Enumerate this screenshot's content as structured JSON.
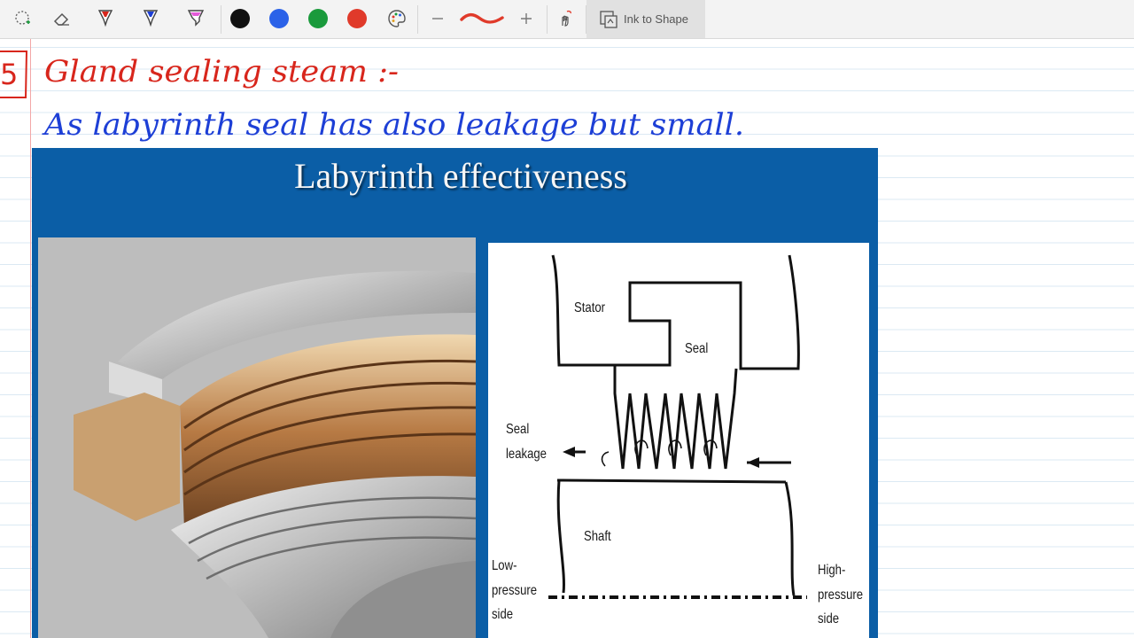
{
  "toolbar": {
    "tools": [
      {
        "name": "lasso-select"
      },
      {
        "name": "eraser"
      },
      {
        "name": "pen-red"
      },
      {
        "name": "pen-blue"
      },
      {
        "name": "highlighter-pink"
      }
    ],
    "colors": [
      "#111111",
      "#2b62e8",
      "#1a9a3c",
      "#e03a2a"
    ],
    "ink_to_shape_label": "Ink to Shape"
  },
  "notes": {
    "number": "5",
    "heading": "Gland sealing steam :-",
    "line": "As labyrinth seal has also leakage but small."
  },
  "slide": {
    "title": "Labyrinth effectiveness",
    "diagram": {
      "stator": "Stator",
      "seal": "Seal",
      "seal_leakage_1": "Seal",
      "seal_leakage_2": "leakage",
      "shaft": "Shaft",
      "low_1": "Low-",
      "low_2": "pressure",
      "low_3": "side",
      "high_1": "High-",
      "high_2": "pressure",
      "high_3": "side"
    }
  },
  "colors": {
    "red_ink": "#d8261c",
    "blue_ink": "#1d3fd6",
    "slide_bg": "#0b5ea6"
  }
}
